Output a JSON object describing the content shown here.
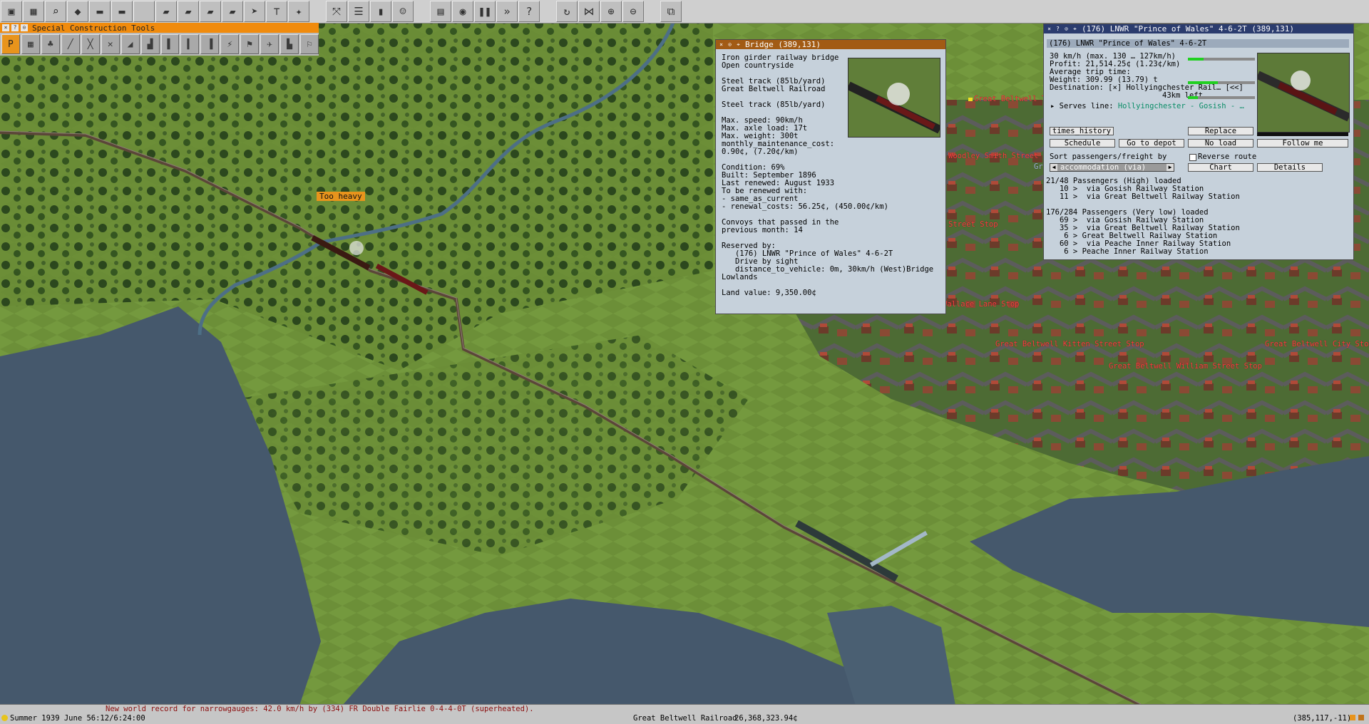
{
  "toolbar": {
    "icons": [
      "save-icon",
      "map-editor-icon",
      "magnifier-icon",
      "landscape-icon",
      "locomotive-green-icon",
      "locomotive-red-icon",
      "blank-icon",
      "train-blue-icon",
      "truck-red-icon",
      "bus-red-icon",
      "tram-icon",
      "highspeed-train-icon",
      "crossing-icon",
      "special-tools-icon",
      "road-construction-icon",
      "list-icon",
      "canister-icon",
      "players-icon",
      "map-icon",
      "camera-icon",
      "pause-icon",
      "fast-forward-icon",
      "help-icon",
      "rotate-icon",
      "grid-icon",
      "zoom-in-icon",
      "zoom-out-icon",
      "network-icon"
    ]
  },
  "special_tools": {
    "title": "Special Construction Tools",
    "tool_icons": [
      "signal-p-icon",
      "station-icon",
      "tree-icon",
      "rail-icon",
      "bridge-icon",
      "crossing-icon",
      "tunnel-icon",
      "wayobj-icon",
      "pillar-icon",
      "halt-icon",
      "depot-icon",
      "electrify-icon",
      "flag-icon",
      "plane-icon",
      "factory-icon",
      "roadsign-icon"
    ]
  },
  "bridge_window": {
    "title": "Bridge (389,131)",
    "text": "Iron girder railway bridge\nOpen countryside\n\nSteel track (85lb/yard)\nGreat Beltwell Railroad\n\nSteel track (85lb/yard)\n\nMax. speed: 90km/h\nMax. axle load: 17t\nMax. weight: 300t\nmonthly_maintenance_cost:\n0.90¢, (7.20¢/km)\n\nCondition: 69%\nBuilt: September 1896\nLast renewed: August 1933\nTo be renewed with:\n- same_as_current\n- renewal_costs: 56.25¢, (450.00¢/km)\n\nConvoys that passed in the\nprevious month: 14\n\nReserved by:\n   (176) LNWR \"Prince of Wales\" 4-6-2T\n   Drive by sight\n   distance_to_vehicle: 0m, 30km/h (West)Bridge\nLowlands\n\nLand value: 9,350.00¢"
  },
  "vehicle_window": {
    "title": "(176) LNWR \"Prince of Wales\" 4-6-2T (389,131)",
    "name": "(176) LNWR \"Prince of Wales\" 4-6-2T",
    "stats": "30 km/h (max. 130 … 127km/h)\nProfit: 21,514.25¢ (1.23¢/km)\nAverage trip time:\nWeight: 309.99 (13.79) t\nDestination: [×] Hollyingchester Rail… [<<]\n                         43km left",
    "serves_label": "Serves line:",
    "serves_line": "Hollyingchester - Gosish - …",
    "buttons": {
      "times_history": "times_history",
      "replace": "Replace",
      "schedule": "Schedule",
      "go_to_depot": "Go to depot",
      "no_load": "No load",
      "follow_me": "Follow me",
      "chart": "Chart",
      "details": "Details"
    },
    "sort_label": "Sort passengers/freight by",
    "reverse_route": "Reverse route",
    "sort_value": "accommodation (via)",
    "speed_fraction": 0.23,
    "weight_fraction": 0.45,
    "trip_fraction": 0.15,
    "cargo": "21/48 Passengers (High) loaded\n   10 >  via Gosish Railway Station\n   11 >  via Great Beltwell Railway Station\n\n176/284 Passengers (Very low) loaded\n   69 >  via Gosish Railway Station\n   35 >  via Great Beltwell Railway Station\n    6 > Great Beltwell Railway Station\n   60 >  via Peache Inner Railway Station\n    6 > Peache Inner Railway Station"
  },
  "map_labels": {
    "too_heavy": "Too heavy",
    "stops": [
      "Great Beltwell Tra",
      "Woodley Smith Street St",
      "Gr",
      "Street Stop",
      "Wallace Lane Stop",
      "Great Beltwell Kitten Street Stop",
      "Great Beltwell William Street Stop",
      "Great Beltwell City Stop"
    ]
  },
  "status_bar": {
    "news": "New world record for narrowgauges: 42.0 km/h by (334) FR Double Fairlie 0-4-4-0T (superheated).",
    "date": "Summer 1939 June 56:12/6:24:00",
    "company": "Great Beltwell Railroad",
    "money": "26,368,323.94¢",
    "coords": "(385,117,-11)"
  },
  "colors": {
    "grass": "#6c8f3a",
    "water": "#45586c",
    "bridge_title": "#a25b14",
    "vehicle_title": "#2b3c6e",
    "stop_label": "#ff3c3c",
    "line_link": "#0a8d67"
  }
}
